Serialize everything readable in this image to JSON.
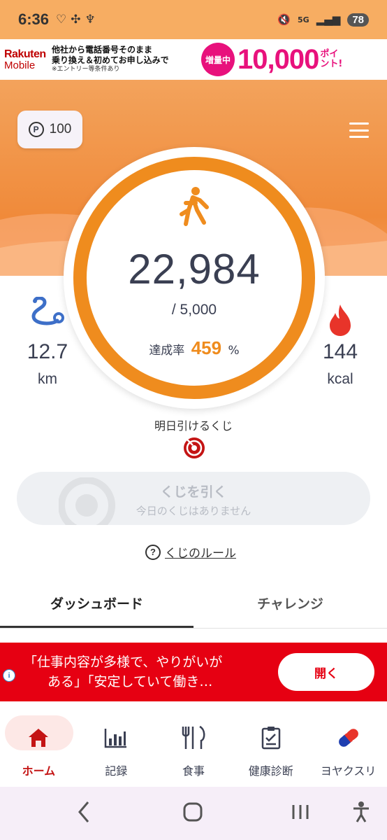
{
  "status_bar": {
    "time": "6:36",
    "battery": "78",
    "network": "5G"
  },
  "top_ad": {
    "brand_line1": "Rakuten",
    "brand_line2": "Mobile",
    "line1": "他社から電話番号そのまま",
    "line2": "乗り換え＆初めてお申し込みで",
    "note": "※エントリー等条件あり",
    "badge": "増量中",
    "amount": "10,000",
    "points_word": "ポイント!"
  },
  "header": {
    "points": "100",
    "points_symbol": "P"
  },
  "activity": {
    "steps": "22,984",
    "goal": "/ 5,000",
    "rate_label": "達成率",
    "rate_value": "459",
    "rate_unit": "%",
    "distance": "12.7",
    "distance_unit": "km",
    "calories": "144",
    "calories_unit": "kcal",
    "progress_fraction": 1.0
  },
  "kuji": {
    "tomorrow_label": "明日引けるくじ",
    "button_title": "くじを引く",
    "button_sub": "今日のくじはありません",
    "rules_link": "くじのルール"
  },
  "tabs": [
    {
      "label": "ダッシュボード",
      "active": true
    },
    {
      "label": "チャレンジ",
      "active": false
    }
  ],
  "bottom_ad": {
    "message_line1": "「仕事内容が多様で、やりがいが",
    "message_line2": "ある」「安定していて働き…",
    "button": "開く",
    "info_icon": "i"
  },
  "bottom_nav": [
    {
      "label": "ホーム",
      "icon": "home-icon",
      "active": true
    },
    {
      "label": "記録",
      "icon": "chart-icon",
      "active": false
    },
    {
      "label": "食事",
      "icon": "meal-icon",
      "active": false
    },
    {
      "label": "健康診断",
      "icon": "checklist-icon",
      "active": false
    },
    {
      "label": "ヨヤクスリ",
      "icon": "pill-icon",
      "active": false
    }
  ],
  "colors": {
    "accent": "#ef8c1e",
    "ad_red": "#e60012",
    "nav_active": "#c41414"
  }
}
